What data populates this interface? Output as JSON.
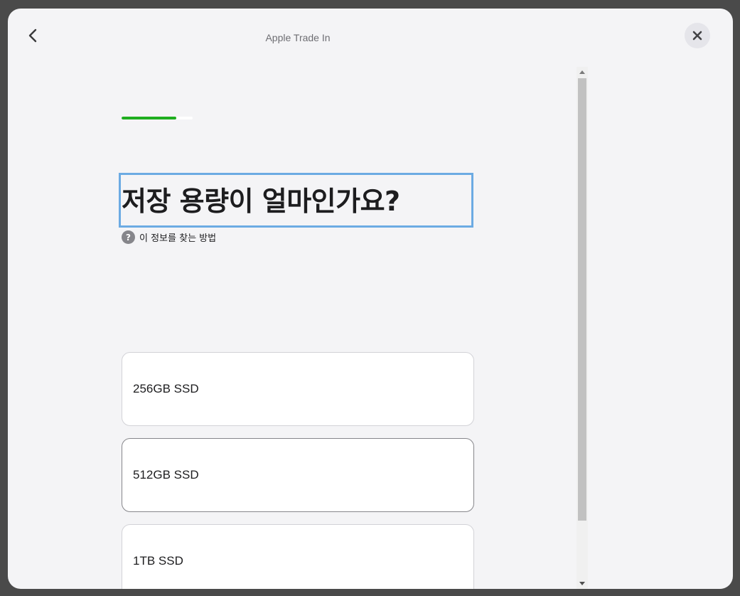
{
  "window": {
    "title": "Apple Trade In"
  },
  "progress": {
    "fraction": 0.77,
    "color": "#1fae1f"
  },
  "question": {
    "title": "저장 용량이 얼마인가요?",
    "help_link": "이 정보를 찾는 방법",
    "help_icon_glyph": "?"
  },
  "options": [
    {
      "label": "256GB SSD"
    },
    {
      "label": "512GB SSD"
    },
    {
      "label": "1TB SSD"
    }
  ],
  "icons": {
    "back": "chevron-left-icon",
    "close": "close-icon",
    "help": "question-circle-icon",
    "scroll_up": "triangle-up-icon",
    "scroll_down": "triangle-down-icon"
  }
}
